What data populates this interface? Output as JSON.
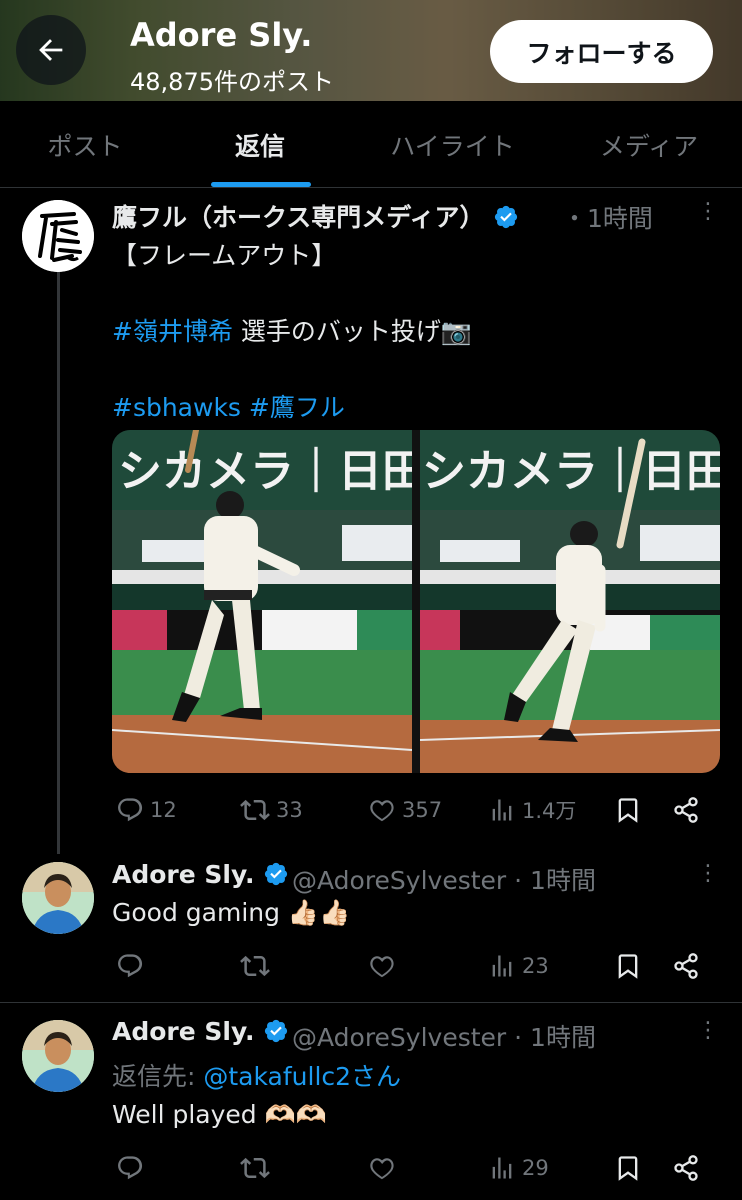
{
  "header": {
    "title": "Adore Sly.",
    "post_count": "48,875件のポスト",
    "follow_label": "フォローする",
    "back_icon": "arrow-left-icon"
  },
  "tabs": [
    {
      "label": "ポスト",
      "active": false
    },
    {
      "label": "返信",
      "active": true
    },
    {
      "label": "ハイライト",
      "active": false
    },
    {
      "label": "メディア",
      "active": false
    }
  ],
  "colors": {
    "accent": "#1d9bf0",
    "background": "#000000",
    "text": "#e7e9ea",
    "muted": "#71767b"
  },
  "posts": [
    {
      "author": "鷹フル（ホークス専門メディア）",
      "verified": true,
      "time": "・1時間",
      "line1": "【フレームアウト】",
      "hashtag_player": "#嶺井博希",
      "line2_rest": " 選手のバット投げ📷",
      "hashtag_team": "#sbhawks",
      "hashtag_media": "#鷹フル",
      "photo_banner_left": "シカメラ｜日田",
      "photo_banner_right": "シカメラ｜日田",
      "stats": {
        "replies": "12",
        "reposts": "33",
        "likes": "357",
        "views": "1.4万"
      }
    },
    {
      "author": "Adore Sly.",
      "verified": true,
      "handle_time": "@AdoreSylvester · 1時間",
      "text": "Good gaming 👍🏻👍🏻",
      "stats": {
        "replies": "",
        "reposts": "",
        "likes": "",
        "views": "23"
      }
    },
    {
      "author": "Adore Sly.",
      "verified": true,
      "handle_time": "@AdoreSylvester · 1時間",
      "reply_prefix": "返信先: ",
      "reply_to": "@takafullc2さん",
      "text": "Well played 🫶🏻🫶🏻",
      "stats": {
        "replies": "",
        "reposts": "",
        "likes": "",
        "views": "29"
      }
    }
  ]
}
